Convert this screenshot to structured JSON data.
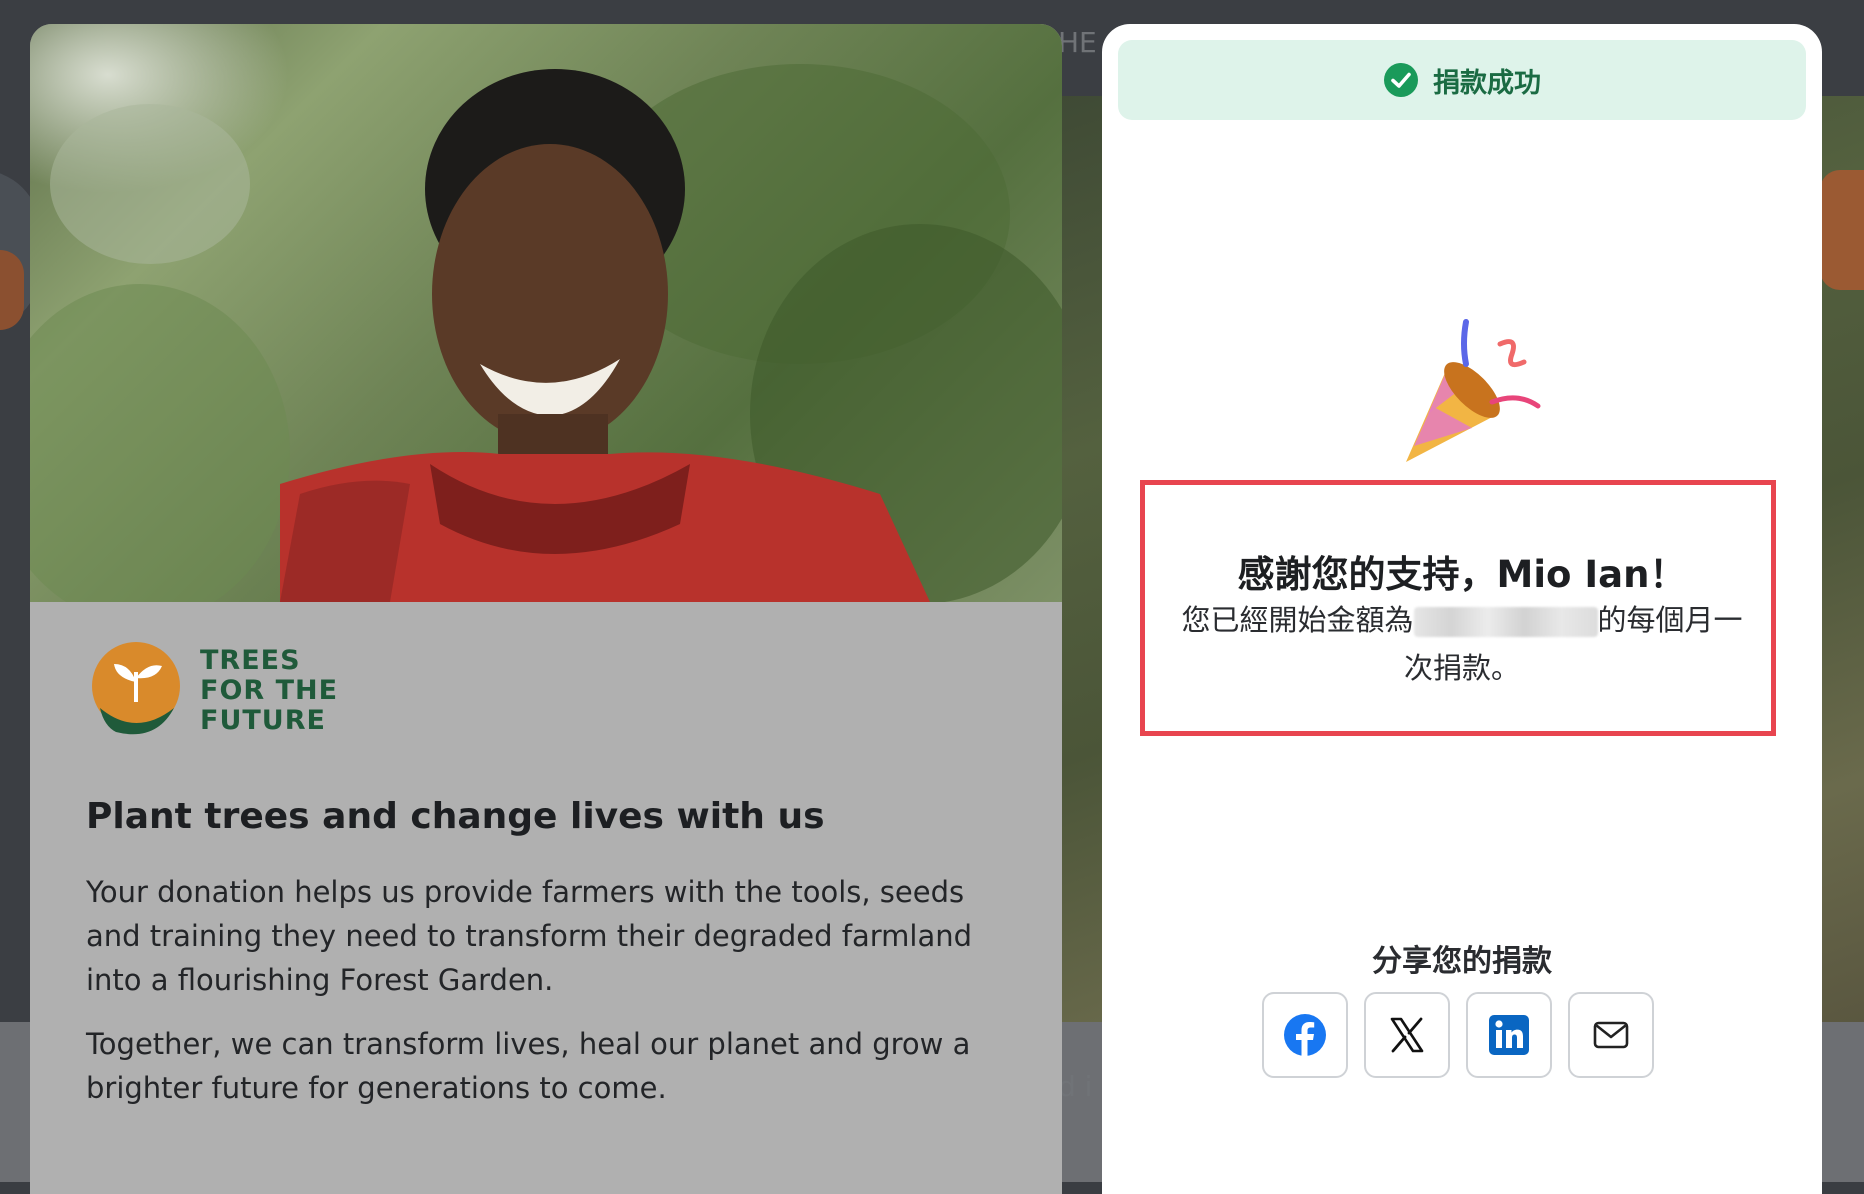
{
  "campaign": {
    "org_name_lines": [
      "TREES",
      "FOR THE",
      "FUTURE"
    ],
    "title": "Plant trees and change lives with us",
    "paragraph_1": "Your donation helps us provide farmers with the tools, seeds and training they need to transform their degraded farmland into a flourishing Forest Garden.",
    "paragraph_2": "Together, we can transform lives, heal our planet and grow a brighter future for generations to come."
  },
  "success_panel": {
    "banner_text": "捐款成功",
    "thanks_title": "感謝您的支持，Mio Ian！",
    "message_before": "您已經開始金額為",
    "message_after": "的每個月一次捐款。",
    "share_title": "分享您的捐款",
    "share_buttons": [
      "facebook-icon",
      "x-icon",
      "linkedin-icon",
      "email-icon"
    ]
  },
  "background_text": {
    "header_fragment": "HE",
    "body_fragment": "d i"
  },
  "colors": {
    "success_green": "#1a6b43",
    "banner_bg": "#def3ea",
    "highlight_red": "#e8454f",
    "brand_green": "#1f5a3a",
    "brand_orange": "#d98a2b",
    "facebook_blue": "#1877f2",
    "linkedin_blue": "#0a66c2"
  }
}
